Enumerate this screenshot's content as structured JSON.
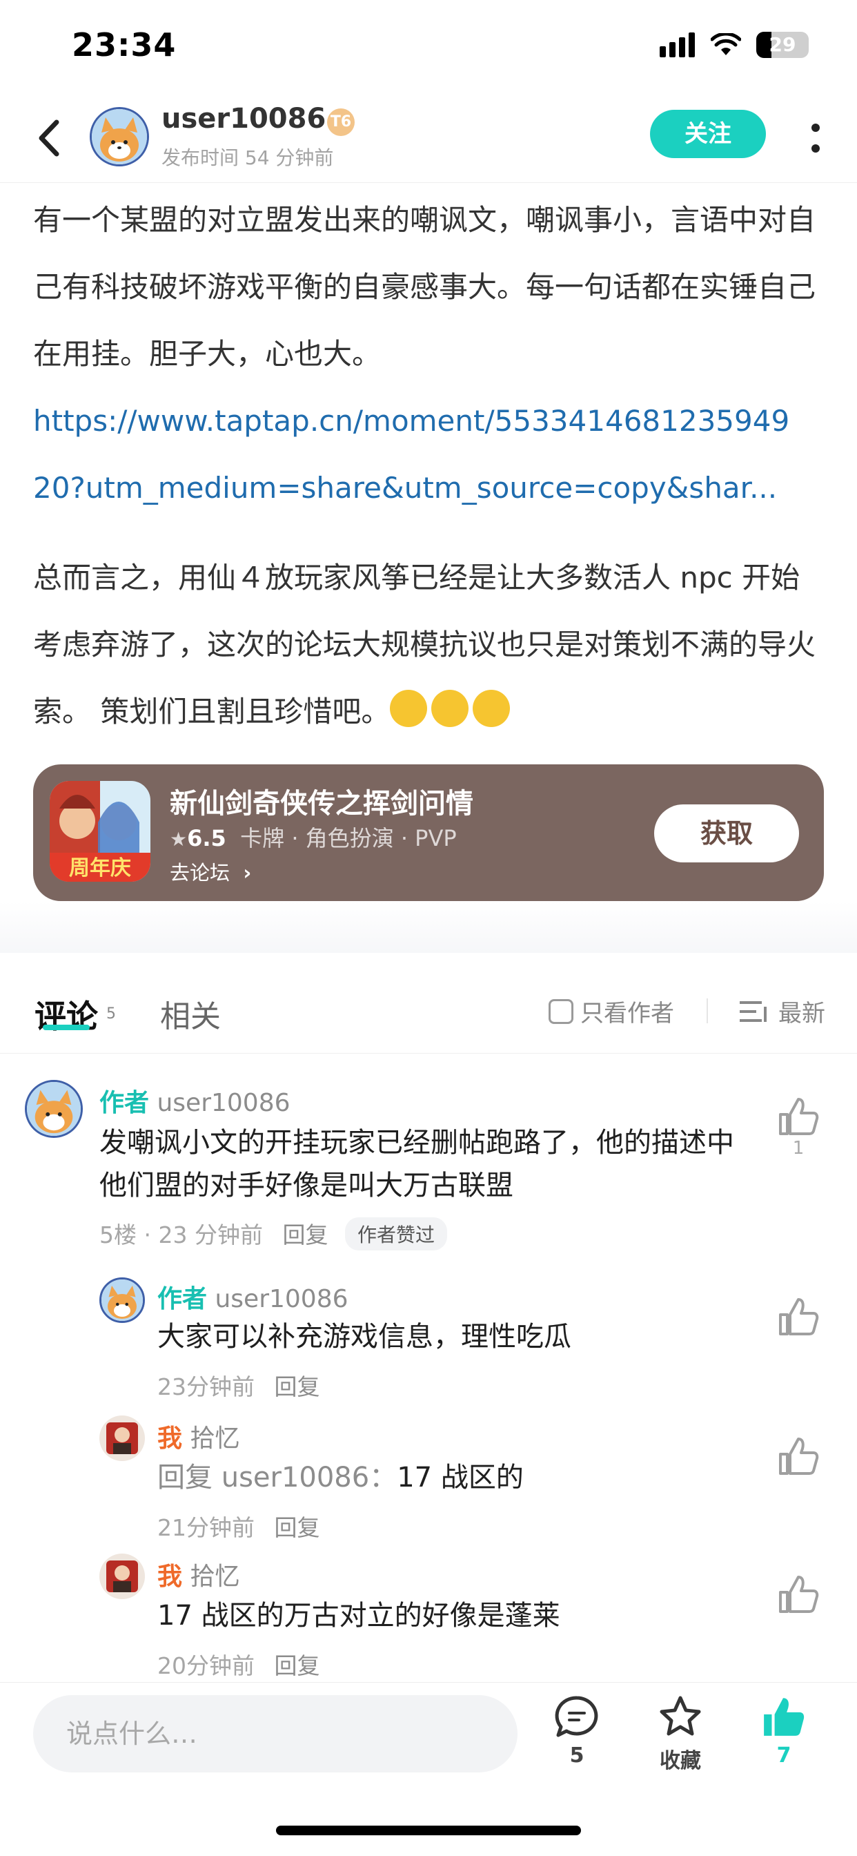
{
  "status_bar": {
    "time": "23:34",
    "battery": "29"
  },
  "header": {
    "author_name": "user10086",
    "level_badge": "T6",
    "post_time": "发布时间 54 分钟前",
    "follow_label": "关注",
    "icons": [
      "back-arrow-icon",
      "more-icon"
    ]
  },
  "post": {
    "paragraph_1": "有一个某盟的对立盟发出来的嘲讽文，嘲讽事小，言语中对自己有科技破坏游戏平衡的自豪感事大。每一句话都在实锤自己在用挂。胆子大，心也大。",
    "link_line_1": "https://www.taptap.cn/moment/5533414681235949",
    "link_line_2": "20?utm_medium=share&utm_source=copy&shar...",
    "paragraph_2": "总而言之，用仙４放玩家风筝已经是让大多数活人 npc 开始考虑弃游了，这次的论坛大规模抗议也只是对策划不满的导火索。 策划们且割且珍惜吧。"
  },
  "game_card": {
    "title": "新仙剑奇侠传之挥剑问情",
    "rating": "6.5",
    "tags": "卡牌 · 角色扮演 · PVP",
    "forum_link": "去论坛",
    "get_label": "获取",
    "icon_text": "周年庆",
    "background": "#7b6660"
  },
  "tabs": {
    "comments_label": "评论",
    "comments_count": "5",
    "related_label": "相关",
    "author_only_label": "只看作者",
    "sort_label": "最新"
  },
  "comments": [
    {
      "tag": "作者",
      "name": "user10086",
      "text": "发嘲讽小文的开挂玩家已经删帖跑路了，他的描述中他们盟的对手好像是叫大万古联盟",
      "meta": "5楼 · 23 分钟前",
      "reply_label": "回复",
      "pill": "作者赞过",
      "likes": "1"
    },
    {
      "tag": "作者",
      "name": "user10086",
      "text": "大家可以补充游戏信息，理性吃瓜",
      "meta": "23分钟前",
      "reply_label": "回复"
    },
    {
      "tag": "我",
      "name": "拾忆",
      "reply_prefix": "回复 user10086：",
      "text": "17 战区的",
      "meta": "21分钟前",
      "reply_label": "回复"
    },
    {
      "tag": "我",
      "name": "拾忆",
      "text": "17 战区的万古对立的好像是蓬莱",
      "meta": "20分钟前",
      "reply_label": "回复"
    }
  ],
  "bottom_bar": {
    "input_placeholder": "说点什么…",
    "comment_count": "5",
    "favorite_label": "收藏",
    "like_count": "7",
    "accent": "#1bd0c0"
  }
}
